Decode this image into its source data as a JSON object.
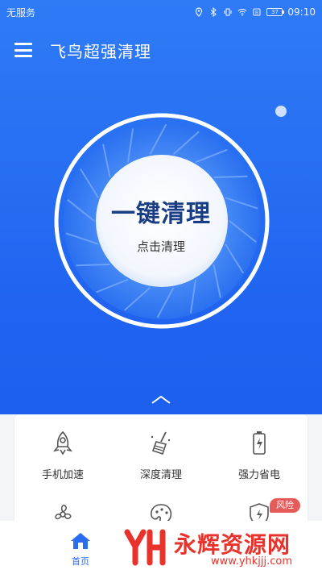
{
  "status_bar": {
    "carrier": "无服务",
    "battery": "37",
    "time": "09:10"
  },
  "app_bar": {
    "title": "飞鸟超强清理",
    "menu_icon": "hamburger-menu-icon"
  },
  "cleaner": {
    "title": "一键清理",
    "subtitle": "点击清理"
  },
  "tools": [
    {
      "label": "手机加速",
      "icon": "rocket-icon"
    },
    {
      "label": "深度清理",
      "icon": "broom-icon"
    },
    {
      "label": "强力省电",
      "icon": "battery-icon"
    },
    {
      "label": "",
      "icon": "fan-icon"
    },
    {
      "label": "",
      "icon": "palette-icon"
    },
    {
      "label": "",
      "icon": "shield-bolt-icon",
      "badge": "风险"
    }
  ],
  "bottom_nav": {
    "home_label": "首页"
  },
  "watermark": {
    "text": "永辉资源网",
    "url": "www.yhkjjj.com"
  },
  "colors": {
    "primary": "#2a6cf0",
    "background_top": "#2f7bf6",
    "badge": "#e65a5a",
    "watermark": "#e8322b"
  }
}
